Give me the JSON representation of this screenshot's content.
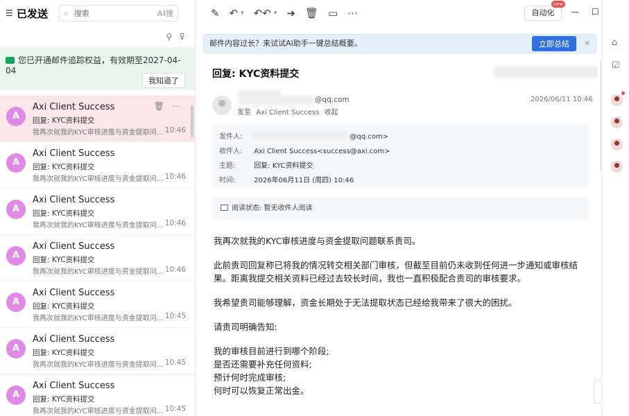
{
  "left_panel": {
    "folder_title": "已发送",
    "search_placeholder": "搜索",
    "search_ai": "AI搜",
    "notice_text": "您已开通邮件追踪权益，有效期至2027-04-04",
    "notice_button": "我知道了",
    "mails": [
      {
        "avatar": "A",
        "sender": "Axi Client Success",
        "subject": "回复:  KYC资料提交",
        "preview": "我再次就我的KYC审核进度与资金提取问题联系贵司。",
        "time": "10:46"
      },
      {
        "avatar": "A",
        "sender": "Axi Client Success",
        "subject": "回复:  KYC资料提交",
        "preview": "我再次就我的KYC审核进度与资金提取问题联系贵司。",
        "time": "10:46"
      },
      {
        "avatar": "A",
        "sender": "Axi Client Success",
        "subject": "回复:  KYC资料提交",
        "preview": "我再次就我的KYC审核进度与资金提取问题联系贵司。",
        "time": "10:46"
      },
      {
        "avatar": "A",
        "sender": "Axi Client Success",
        "subject": "回复:  KYC资料提交",
        "preview": "我再次就我的KYC审核进度与资金提取问题联系贵司。",
        "time": "10:46"
      },
      {
        "avatar": "A",
        "sender": "Axi Client Success",
        "subject": "回复:  KYC资料提交",
        "preview": "我再次就我的KYC审核进度与资金提取问题联系贵司。",
        "time": "10:45"
      },
      {
        "avatar": "A",
        "sender": "Axi Client Success",
        "subject": "回复:  KYC资料提交",
        "preview": "我再次就我的KYC审核进度与资金提取问题联系贵司。",
        "time": "10:45"
      },
      {
        "avatar": "A",
        "sender": "Axi Client Success",
        "subject": "回复:  KYC资料提交",
        "preview": "我再次就我的KYC审核进度与资金提取问题联系贵司。",
        "time": "10:45"
      }
    ]
  },
  "toolbar": {
    "auto_label": "自动化",
    "new_badge": "new"
  },
  "ai_banner": {
    "text": "邮件内容过长？来试试AI助手一键总结概要。",
    "button": "立即总结"
  },
  "mail": {
    "title": "回复:  KYC资料提交",
    "from_email": "@qq.com",
    "send_to_prefix": "发至",
    "send_to_name": "Axi Client Success",
    "collapse": "收起",
    "datetime": "2026/06/11 10:46",
    "info": {
      "sender_label": "发件人:",
      "sender_value": "@qq.com>",
      "recipient_label": "收件人:",
      "recipient_value": "Axi Client Success<success@axi.com>",
      "subject_label": "主题:",
      "subject_value": "回复:  KYC资料提交",
      "time_label": "时间:",
      "time_value": "2026年06月11日 (周四)  10:46"
    },
    "read_status": "阅读状态: 暂无收件人阅读",
    "body": {
      "p1": "我再次就我的KYC审核进度与资金提取问题联系贵司。",
      "p2": "此前贵司回复称已将我的情况转交相关部门审核，但截至目前仍未收到任何进一步通知或审核结果。距离我提交相关资料已经过去较长时间，我也一直积极配合贵司的审核要求。",
      "p3": "我希望贵司能够理解，资金长期处于无法提取状态已经给我带来了很大的困扰。",
      "p4": "请贵司明确告知:",
      "l1": "我的审核目前进行到哪个阶段;",
      "l2": "是否还需要补充任何资料;",
      "l3": "预计何时完成审核;",
      "l4": "何时可以恢复正常出金。"
    }
  },
  "colors": {
    "accent": "#2f6fe0",
    "selected_row": "#fbe7e8",
    "avatar": "#df8be5",
    "notice_bg": "#e9f6ee"
  }
}
